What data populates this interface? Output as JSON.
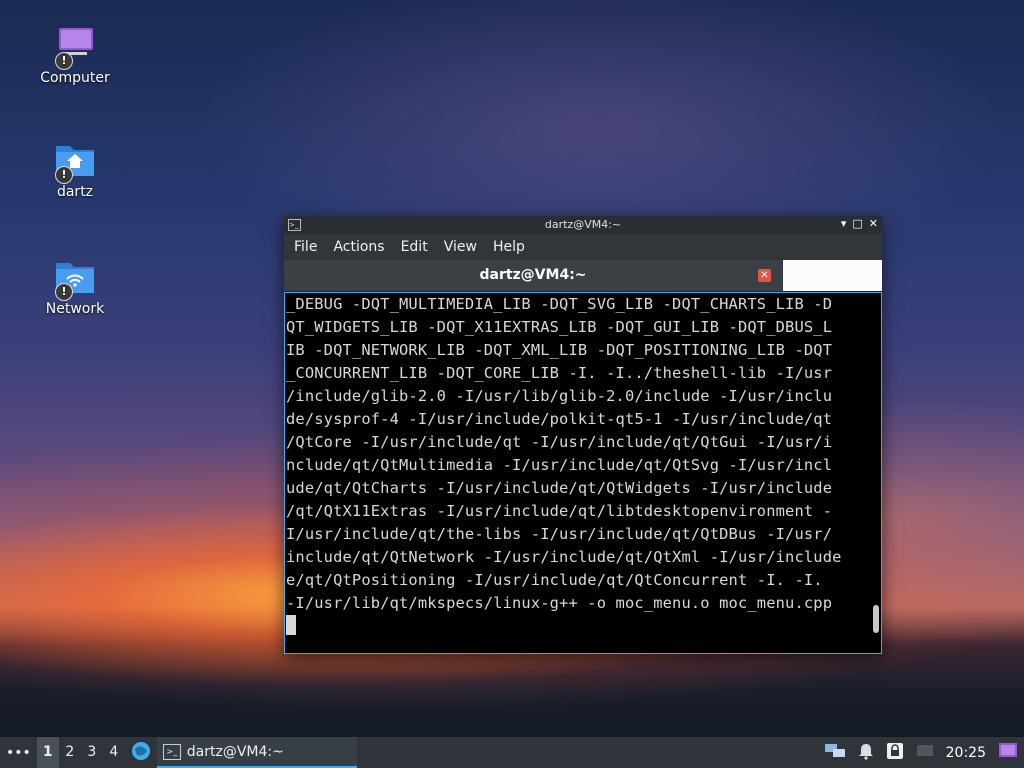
{
  "desktop": {
    "icons": [
      {
        "label": "Computer",
        "icon": "computer-icon"
      },
      {
        "label": "dartz",
        "icon": "home-folder-icon"
      },
      {
        "label": "Network",
        "icon": "network-folder-icon"
      }
    ],
    "badge": "!"
  },
  "window": {
    "title": "dartz@VM4:~",
    "buttons": {
      "minimize": "▾",
      "maximize": "□",
      "close": "✕"
    },
    "menu": [
      "File",
      "Actions",
      "Edit",
      "View",
      "Help"
    ],
    "tab_title": "dartz@VM4:~",
    "terminal_lines": [
      "_DEBUG -DQT_MULTIMEDIA_LIB -DQT_SVG_LIB -DQT_CHARTS_LIB -D",
      "QT_WIDGETS_LIB -DQT_X11EXTRAS_LIB -DQT_GUI_LIB -DQT_DBUS_L",
      "IB -DQT_NETWORK_LIB -DQT_XML_LIB -DQT_POSITIONING_LIB -DQT",
      "_CONCURRENT_LIB -DQT_CORE_LIB -I. -I../theshell-lib -I/usr",
      "/include/glib-2.0 -I/usr/lib/glib-2.0/include -I/usr/inclu",
      "de/sysprof-4 -I/usr/include/polkit-qt5-1 -I/usr/include/qt",
      "/QtCore -I/usr/include/qt -I/usr/include/qt/QtGui -I/usr/i",
      "nclude/qt/QtMultimedia -I/usr/include/qt/QtSvg -I/usr/incl",
      "ude/qt/QtCharts -I/usr/include/qt/QtWidgets -I/usr/include",
      "/qt/QtX11Extras -I/usr/include/qt/libtdesktopenvironment -",
      "I/usr/include/qt/the-libs -I/usr/include/qt/QtDBus -I/usr/",
      "include/qt/QtNetwork -I/usr/include/qt/QtXml -I/usr/include",
      "e/qt/QtPositioning -I/usr/include/qt/QtConcurrent -I. -I.",
      "-I/usr/lib/qt/mkspecs/linux-g++ -o moc_menu.o moc_menu.cpp"
    ]
  },
  "taskbar": {
    "more": "•••",
    "workspaces": [
      "1",
      "2",
      "3",
      "4"
    ],
    "active_workspace": "1",
    "task_label": "dartz@VM4:~",
    "clock": "20:25"
  },
  "colors": {
    "accent": "#3daee9",
    "panel": "#2f343a",
    "close_tab": "#e8543f"
  }
}
